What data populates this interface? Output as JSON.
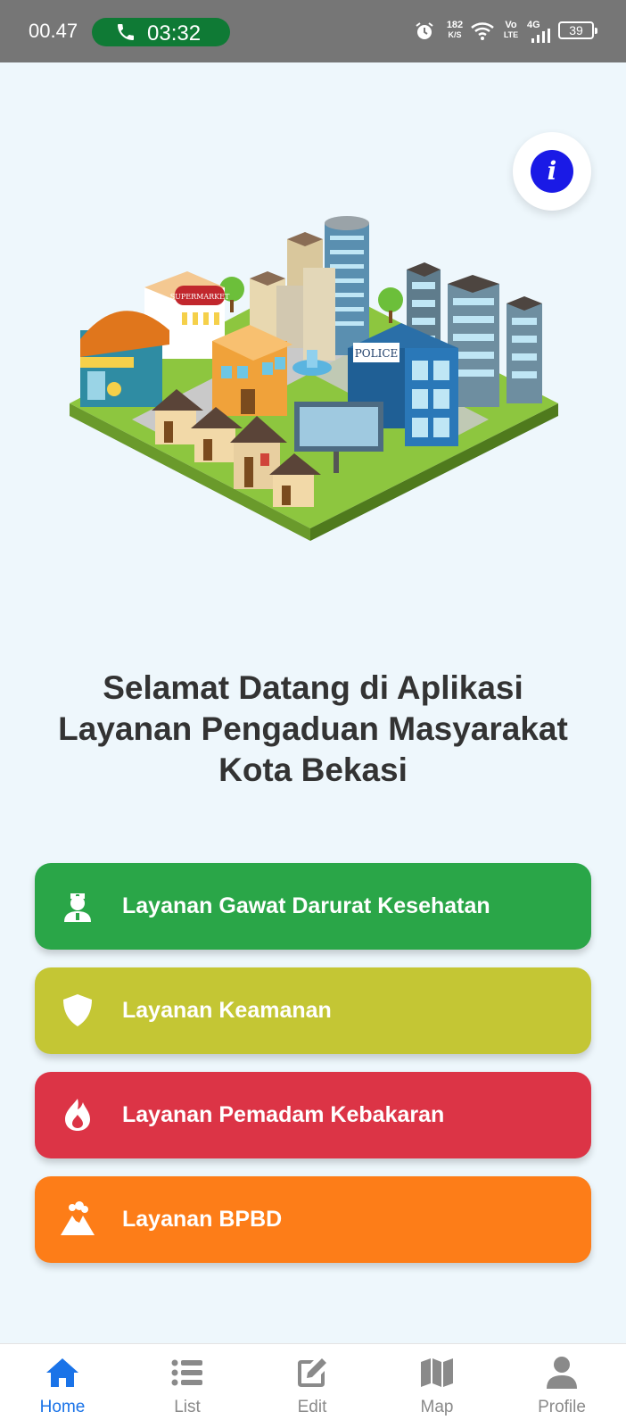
{
  "status_bar": {
    "time": "00.47",
    "call_duration": "03:32",
    "net_speed_top": "182",
    "net_speed_bottom": "K/S",
    "volte_top": "Vo",
    "volte_bottom": "LTE",
    "network": "4G",
    "battery": "39",
    "icons": [
      "alarm-icon",
      "wifi-icon",
      "signal-icon",
      "battery-icon",
      "phone-icon"
    ]
  },
  "info_button": {
    "icon": "info-icon",
    "glyph": "i"
  },
  "welcome": {
    "line1": "Selamat Datang di Aplikasi",
    "line2": "Layanan Pengaduan Masyarakat",
    "line3": "Kota Bekasi"
  },
  "illustration": {
    "supermarket_sign": "SUPERMARKET",
    "police_sign": "POLICE"
  },
  "services": [
    {
      "label": "Layanan Gawat Darurat Kesehatan",
      "icon": "medic-icon",
      "color": "#2aa648"
    },
    {
      "label": "Layanan Keamanan",
      "icon": "shield-icon",
      "color": "#c4c634"
    },
    {
      "label": "Layanan Pemadam Kebakaran",
      "icon": "fire-icon",
      "color": "#dc3446"
    },
    {
      "label": "Layanan BPBD",
      "icon": "volcano-icon",
      "color": "#fd7d18"
    }
  ],
  "nav": [
    {
      "label": "Home",
      "icon": "home-icon",
      "active": true
    },
    {
      "label": "List",
      "icon": "list-icon",
      "active": false
    },
    {
      "label": "Edit",
      "icon": "edit-icon",
      "active": false
    },
    {
      "label": "Map",
      "icon": "map-icon",
      "active": false
    },
    {
      "label": "Profile",
      "icon": "user-icon",
      "active": false
    }
  ],
  "colors": {
    "active_nav": "#1a73e8",
    "inactive_nav": "#8a8a8a",
    "background": "#eef7fc"
  }
}
